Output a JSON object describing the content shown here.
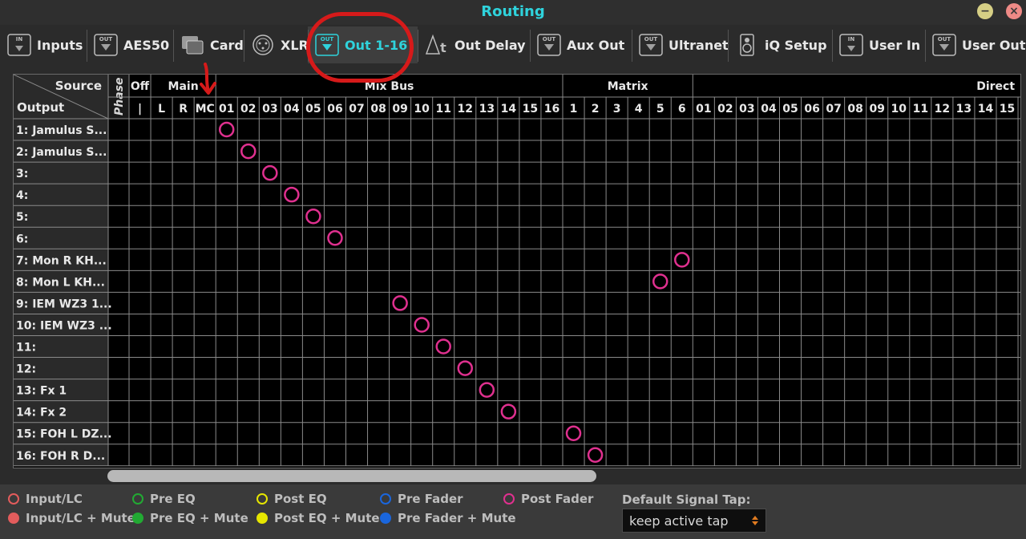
{
  "window": {
    "title": "Routing"
  },
  "tabs": [
    {
      "label": "Inputs",
      "icon": "in-icon",
      "active": false
    },
    {
      "label": "AES50",
      "icon": "out-icon",
      "active": false
    },
    {
      "label": "Card",
      "icon": "card-icon",
      "active": false
    },
    {
      "label": "XLR",
      "icon": "xlr-icon",
      "active": false
    },
    {
      "label": "Out 1-16",
      "icon": "out-icon",
      "active": true
    },
    {
      "label": "Out Delay",
      "icon": "delay-icon",
      "active": false
    },
    {
      "label": "Aux Out",
      "icon": "out-icon",
      "active": false
    },
    {
      "label": "Ultranet",
      "icon": "out-icon",
      "active": false
    },
    {
      "label": "iQ Setup",
      "icon": "speaker-icon",
      "active": false
    },
    {
      "label": "User In",
      "icon": "in-icon",
      "active": false
    },
    {
      "label": "User Out",
      "icon": "out-icon",
      "active": false
    }
  ],
  "icon_text": {
    "in": "IN",
    "out": "OUT"
  },
  "matrix": {
    "corner_source": "Source",
    "corner_output": "Output",
    "phase_label": "Phase",
    "groups": [
      {
        "label": "Off",
        "columns": [
          "|"
        ]
      },
      {
        "label": "Main",
        "columns": [
          "L",
          "R",
          "MC"
        ]
      },
      {
        "label": "Mix Bus",
        "columns": [
          "01",
          "02",
          "03",
          "04",
          "05",
          "06",
          "07",
          "08",
          "09",
          "10",
          "11",
          "12",
          "13",
          "14",
          "15",
          "16"
        ]
      },
      {
        "label": "Matrix",
        "columns": [
          "1",
          "2",
          "3",
          "4",
          "5",
          "6"
        ]
      },
      {
        "label": "Direct",
        "columns": [
          "01",
          "02",
          "03",
          "04",
          "05",
          "06",
          "07",
          "08",
          "09",
          "10",
          "11",
          "12",
          "13",
          "14",
          "15"
        ]
      }
    ],
    "outputs": [
      "1: Jamulus S...",
      "2: Jamulus S...",
      "3:",
      "4:",
      "5:",
      "6:",
      "7: Mon R KH...",
      "8: Mon L KH...",
      "9: IEM WZ3 1...",
      "10: IEM WZ3 ...",
      "11:",
      "12:",
      "13: Fx 1",
      "14: Fx 2",
      "15: FOH L DZ...",
      "16: FOH R D..."
    ],
    "routes": [
      {
        "output": "1: Jamulus S...",
        "group": "Mix Bus",
        "column": "01",
        "tap": "Post Fader"
      },
      {
        "output": "2: Jamulus S...",
        "group": "Mix Bus",
        "column": "02",
        "tap": "Post Fader"
      },
      {
        "output": "3:",
        "group": "Mix Bus",
        "column": "03",
        "tap": "Post Fader"
      },
      {
        "output": "4:",
        "group": "Mix Bus",
        "column": "04",
        "tap": "Post Fader"
      },
      {
        "output": "5:",
        "group": "Mix Bus",
        "column": "05",
        "tap": "Post Fader"
      },
      {
        "output": "6:",
        "group": "Mix Bus",
        "column": "06",
        "tap": "Post Fader"
      },
      {
        "output": "7: Mon R KH...",
        "group": "Matrix",
        "column": "6",
        "tap": "Post Fader"
      },
      {
        "output": "8: Mon L KH...",
        "group": "Matrix",
        "column": "5",
        "tap": "Post Fader"
      },
      {
        "output": "9: IEM WZ3 1...",
        "group": "Mix Bus",
        "column": "09",
        "tap": "Post Fader"
      },
      {
        "output": "10: IEM WZ3 ...",
        "group": "Mix Bus",
        "column": "10",
        "tap": "Post Fader"
      },
      {
        "output": "11:",
        "group": "Mix Bus",
        "column": "11",
        "tap": "Post Fader"
      },
      {
        "output": "12:",
        "group": "Mix Bus",
        "column": "12",
        "tap": "Post Fader"
      },
      {
        "output": "13: Fx 1",
        "group": "Mix Bus",
        "column": "13",
        "tap": "Post Fader"
      },
      {
        "output": "14: Fx 2",
        "group": "Mix Bus",
        "column": "14",
        "tap": "Post Fader"
      },
      {
        "output": "15: FOH L DZ...",
        "group": "Matrix",
        "column": "1",
        "tap": "Post Fader"
      },
      {
        "output": "16: FOH R D...",
        "group": "Matrix",
        "column": "2",
        "tap": "Post Fader"
      }
    ]
  },
  "legend": [
    {
      "label": "Input/LC",
      "color": "#e35c5c",
      "filled": false
    },
    {
      "label": "Input/LC + Mute",
      "color": "#e35c5c",
      "filled": true
    },
    {
      "label": "Pre EQ",
      "color": "#22aa33",
      "filled": false
    },
    {
      "label": "Pre EQ + Mute",
      "color": "#22aa33",
      "filled": true
    },
    {
      "label": "Post EQ",
      "color": "#e6e600",
      "filled": false
    },
    {
      "label": "Post EQ + Mute",
      "color": "#e6e600",
      "filled": true
    },
    {
      "label": "Pre Fader",
      "color": "#1a66dd",
      "filled": false
    },
    {
      "label": "Pre Fader + Mute",
      "color": "#1a66dd",
      "filled": true
    },
    {
      "label": "Post Fader",
      "color": "#e0308f",
      "filled": false
    }
  ],
  "default_signal_tap": {
    "label": "Default Signal Tap:",
    "value": "keep active tap"
  },
  "colors": {
    "accent": "#2fd3dc",
    "annotation": "#d61a1a",
    "route_marker": "#e0308f"
  }
}
